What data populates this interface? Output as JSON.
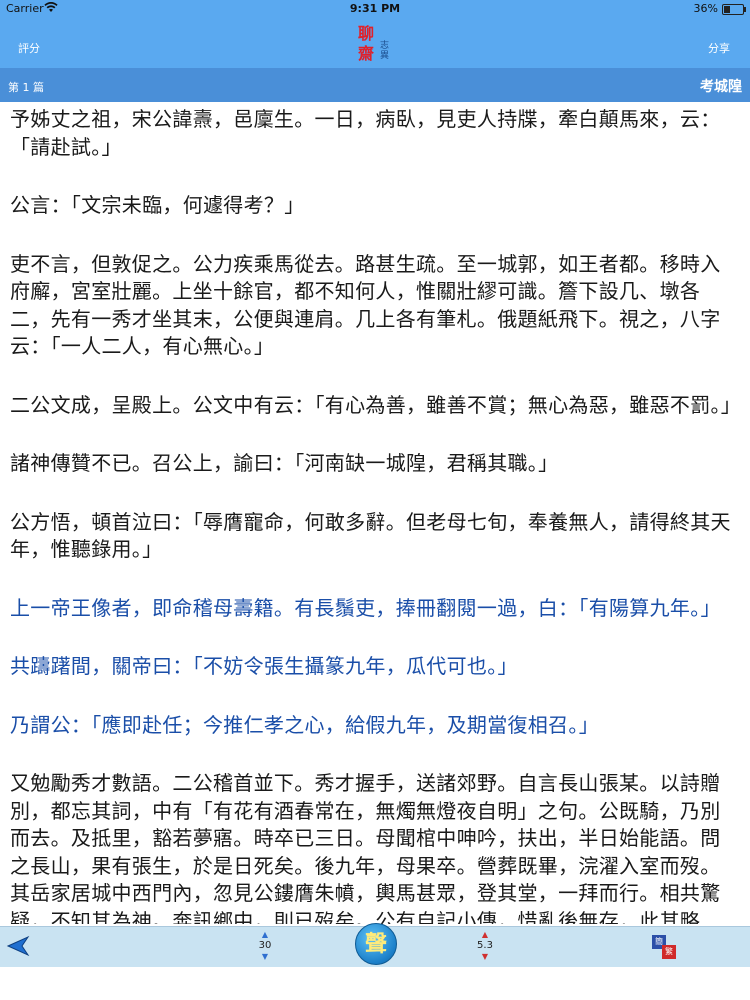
{
  "status_bar": {
    "carrier": "Carrier",
    "time": "9:31 PM",
    "battery": "36%",
    "battery_level": 0.36
  },
  "nav": {
    "left_label": "評分",
    "right_label": "分享",
    "logo_big_1": "聊",
    "logo_big_2": "齋",
    "logo_small_1": "志",
    "logo_small_2": "異"
  },
  "chapter": {
    "number": "第 1 篇",
    "title": "考城隍"
  },
  "content": {
    "paragraphs": [
      {
        "text": "予姊丈之祖，宋公諱燾，邑廩生。一日，病臥，見吏人持牒，牽白顛馬來，云：「請赴試。」",
        "highlight": false
      },
      {
        "text": "公言：「文宗未臨，何遽得考？」",
        "highlight": false
      },
      {
        "text": "吏不言，但敦促之。公力疾乘馬從去。路甚生疏。至一城郭，如王者都。移時入府廨，宮室壯麗。上坐十餘官，都不知何人，惟關壯繆可識。簷下設几、墩各二，先有一秀才坐其末，公便與連肩。几上各有筆札。俄題紙飛下。視之，八字云：「一人二人，有心無心。」",
        "highlight": false
      },
      {
        "text": "二公文成，呈殿上。公文中有云：「有心為善，雖善不賞；無心為惡，雖惡不罰。」",
        "highlight": false
      },
      {
        "text": "諸神傳贊不已。召公上，諭曰：「河南缺一城隍，君稱其職。」",
        "highlight": false
      },
      {
        "text": "公方悟，頓首泣曰：「辱膺寵命，何敢多辭。但老母七旬，奉養無人，請得終其天年，惟聽錄用。」",
        "highlight": false
      },
      {
        "text": "上一帝王像者，即命稽母壽籍。有長鬚吏，捧冊翻閱一過，白：「有陽算九年。」",
        "highlight": true
      },
      {
        "text": "共躊躇間，關帝曰：「不妨令張生攝篆九年，瓜代可也。」",
        "highlight": true
      },
      {
        "text": "乃謂公：「應即赴任；今推仁孝之心，給假九年，及期當復相召。」",
        "highlight": true
      },
      {
        "text": "又勉勵秀才數語。二公稽首並下。秀才握手，送諸郊野。自言長山張某。以詩贈別，都忘其詞，中有「有花有酒春常在，無燭無燈夜自明」之句。公既騎，乃別而去。及抵里，豁若夢寤。時卒已三日。母聞棺中呻吟，扶出，半日始能語。問之長山，果有張生，於是日死矣。後九年，母果卒。營葬既畢，浣濯入室而歿。其岳家居城中西門內，忽見公鏤膺朱幩，輿馬甚眾，登其堂，一拜而行。相共驚疑，不知其為神。奔訊鄉中，則已歿矣。公有自記小傳，惜亂後無存，此其略耳。",
        "highlight": false
      }
    ]
  },
  "toolbar": {
    "font_size": "30",
    "speed": "5.3",
    "voice_label": "聲",
    "script_a": "簡",
    "script_b": "繁"
  },
  "colors": {
    "nav_bg": "#5aa9f0",
    "chapter_bg": "#4a8fd8",
    "toolbar_bg": "#c9e3f2",
    "highlight_text": "#1a4ea8"
  },
  "icons": {
    "back": "back-arrow-icon",
    "wifi": "wifi-icon",
    "battery": "battery-icon"
  }
}
